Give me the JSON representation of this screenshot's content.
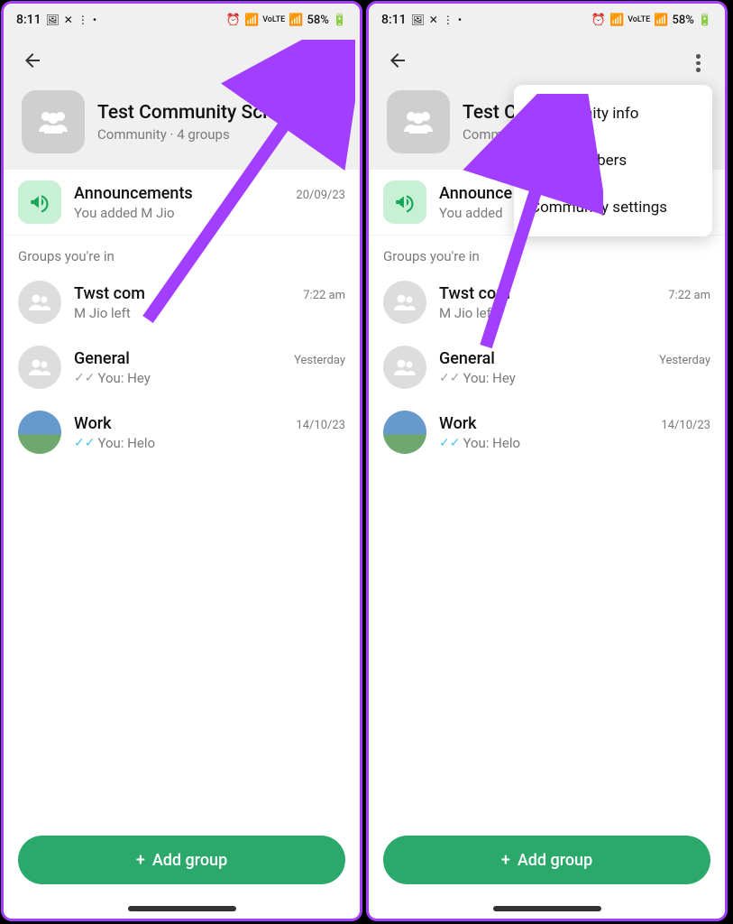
{
  "status": {
    "time": "8:11",
    "battery": "58%"
  },
  "community": {
    "title_full": "Test Community Scho...",
    "title_cut": "Test C",
    "subtitle": "Community · 4 groups",
    "subtitle_cut": "Commu"
  },
  "announcements": {
    "title": "Announcements",
    "title_cut": "Announce",
    "sub": "You added M Jio",
    "sub_cut": "You added",
    "time": "20/09/23"
  },
  "section_label": "Groups you're in",
  "groups": [
    {
      "title": "Twst com",
      "sub": "M Jio left",
      "time": "7:22 am",
      "ticks": "none"
    },
    {
      "title": "General",
      "sub": "You: Hey",
      "time": "Yesterday",
      "ticks": "sent"
    },
    {
      "title": "Work",
      "sub": "You: Helo",
      "time": "14/10/23",
      "ticks": "read"
    }
  ],
  "add_group": "Add group",
  "menu": {
    "item1": "Community info",
    "item2_cut": "e members",
    "item3": "Community settings"
  }
}
